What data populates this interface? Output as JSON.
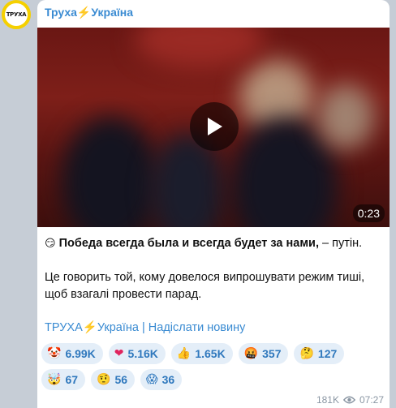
{
  "channel": {
    "avatar_text": "ТРУХА",
    "name": "Труха⚡Україна"
  },
  "media": {
    "duration": "0:23"
  },
  "message": {
    "emoji": "😏",
    "bold_text": "Победа всегда была и всегда будет за нами,",
    "rest_text": " – путін.",
    "second_paragraph": "Це говорить той, кому довелося випрошувати режим тиші, щоб взагалі провести парад."
  },
  "links": {
    "channel_link": "ТРУХА⚡Україна",
    "separator": " | ",
    "submit_link": "Надіслати новину"
  },
  "reactions": [
    {
      "emoji": "🤡",
      "count": "6.99K",
      "icon": "clown-icon"
    },
    {
      "emoji": "❤",
      "count": "5.16K",
      "icon": "heart-icon"
    },
    {
      "emoji": "👍",
      "count": "1.65K",
      "icon": "thumbs-up-icon"
    },
    {
      "emoji": "🤬",
      "count": "357",
      "icon": "angry-face-icon"
    },
    {
      "emoji": "🤔",
      "count": "127",
      "icon": "thinking-face-icon"
    },
    {
      "emoji": "🤯",
      "count": "67",
      "icon": "exploding-head-icon"
    },
    {
      "emoji": "🤨",
      "count": "56",
      "icon": "raised-eyebrow-icon"
    },
    {
      "emoji": "😱",
      "count": "36",
      "icon": "screaming-face-icon"
    }
  ],
  "footer": {
    "views": "181K",
    "time": "07:27"
  },
  "colors": {
    "link": "#3a8bd2",
    "reaction_bg": "#e4eef8",
    "avatar_ring": "#f5d000",
    "background": "#c6cdd6"
  }
}
